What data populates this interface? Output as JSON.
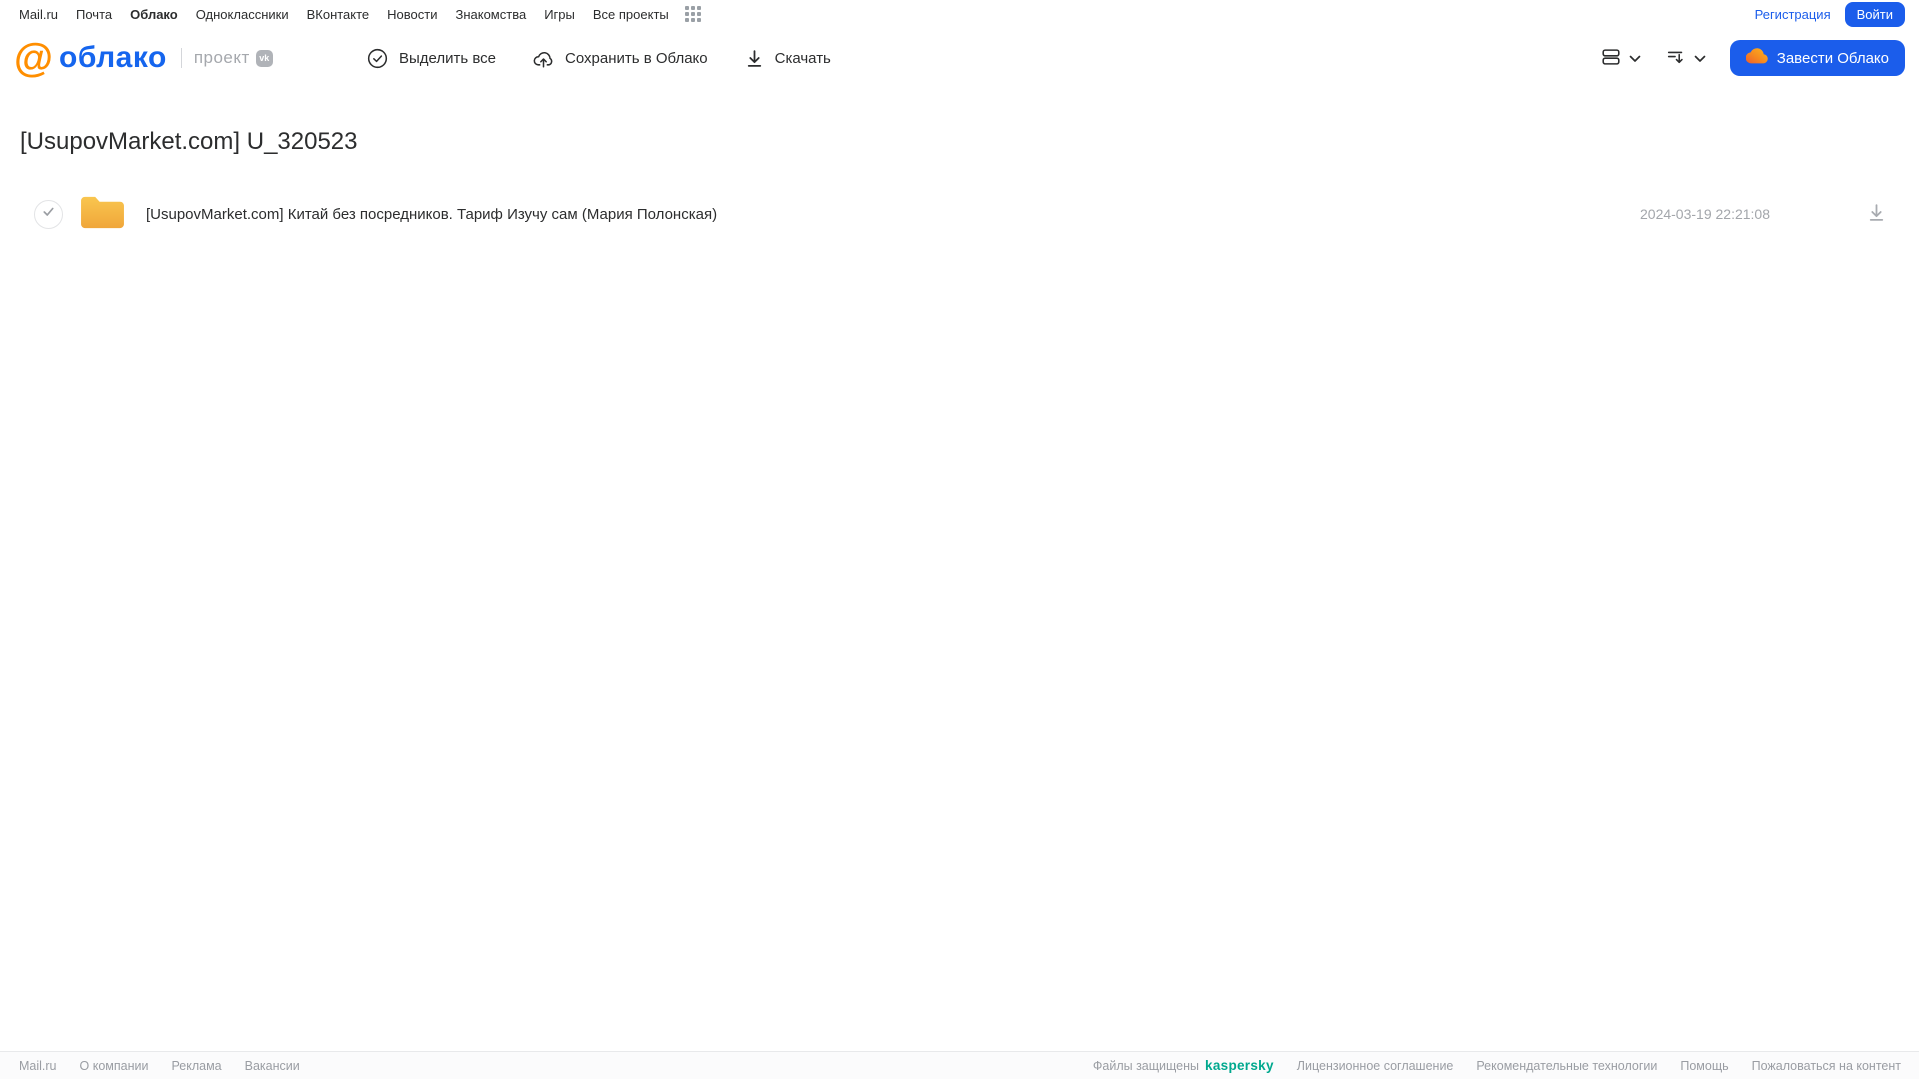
{
  "topnav": {
    "items": [
      {
        "label": "Mail.ru"
      },
      {
        "label": "Почта"
      },
      {
        "label": "Облако",
        "current": true
      },
      {
        "label": "Одноклассники"
      },
      {
        "label": "ВКонтакте"
      },
      {
        "label": "Новости"
      },
      {
        "label": "Знакомства"
      },
      {
        "label": "Игры"
      },
      {
        "label": "Все проекты"
      }
    ],
    "registration_label": "Регистрация",
    "login_label": "Войти"
  },
  "header": {
    "logo_text": "облако",
    "project_label": "проект",
    "vk_badge_label": "vk",
    "toolbar": {
      "select_all_label": "Выделить все",
      "save_to_cloud_label": "Сохранить в Облако",
      "download_label": "Скачать"
    },
    "get_cloud_button_label": "Завести Облако"
  },
  "main": {
    "title": "[UsupovMarket.com] U_320523",
    "files": [
      {
        "name": "[UsupovMarket.com] Китай без посредников. Тариф Изучу сам (Мария Полонская)",
        "date": "2024-03-19 22:21:08",
        "type": "folder"
      }
    ]
  },
  "footer": {
    "left_links": [
      "Mail.ru",
      "О компании",
      "Реклама",
      "Вакансии"
    ],
    "protected_label": "Файлы защищены",
    "kaspersky_label": "kaspersky",
    "right_links": [
      "Лицензионное соглашение",
      "Рекомендательные технологии",
      "Помощь",
      "Пожаловаться на контент"
    ]
  },
  "icons": [
    "apps-grid-icon",
    "check-circle-icon",
    "cloud-upload-icon",
    "download-icon",
    "view-rows-icon",
    "sort-icon",
    "chevron-down-icon",
    "cloud-icon",
    "folder-icon",
    "checkmark-icon",
    "vk-badge-icon",
    "mailru-at-icon"
  ],
  "colors": {
    "accent_blue": "#1b5deb",
    "logo_blue": "#1565ee",
    "logo_orange": "#ff8e00",
    "folder_top": "#f9c64f",
    "folder_bottom": "#f0a63a",
    "kaspersky_green": "#00a88e",
    "muted_gray": "#a3a6ab"
  }
}
